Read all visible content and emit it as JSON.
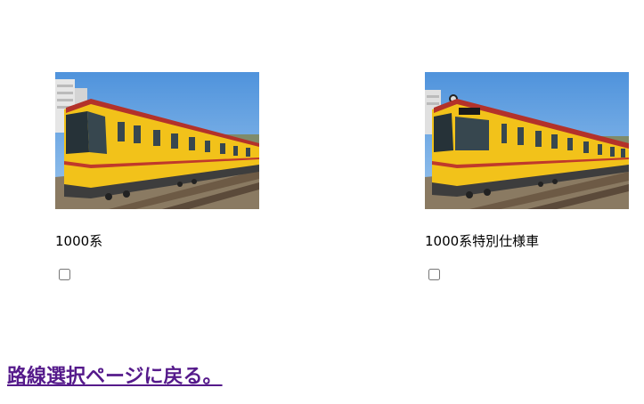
{
  "trains": [
    {
      "label": "1000系",
      "image": "yellow-subway-train-1000-series-photo",
      "checked": false
    },
    {
      "label": "1000系特別仕様車",
      "image": "yellow-subway-train-1000-series-special-photo",
      "checked": false
    }
  ],
  "back_link": {
    "label": "路線選択ページに戻る。"
  },
  "colors": {
    "train_body": "#f2c21a",
    "train_roof": "#b3322a",
    "sky": "#5d9ee0",
    "link_visited": "#551a8b"
  }
}
